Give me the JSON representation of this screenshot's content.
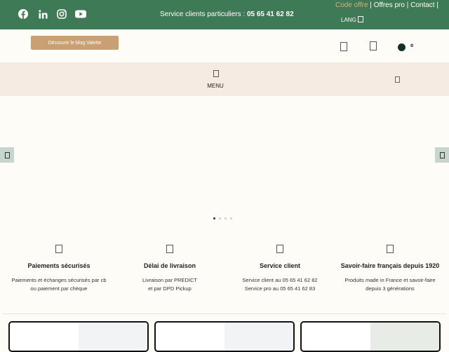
{
  "topbar": {
    "social": [
      {
        "name": "facebook-icon"
      },
      {
        "name": "linkedin-icon"
      },
      {
        "name": "instagram-icon"
      },
      {
        "name": "youtube-icon"
      }
    ],
    "service_text": "Service clients particuliers : ",
    "service_phone": "05 65 41 62 82",
    "links": {
      "code": "Code offre",
      "sep1": " | ",
      "pro": "Offres pro",
      "sep2": " | ",
      "contact": "Contact",
      "sep3": " |"
    },
    "lang": "LANG"
  },
  "header": {
    "blog_button": "Découvrir le blog Valette",
    "cart_count": "0"
  },
  "menu": {
    "label": "MENU"
  },
  "colors": {
    "green": "#3e7a55",
    "tan": "#c9a074",
    "beige": "#f5ebe3"
  },
  "features": [
    {
      "title": "Paiements sécurisés",
      "lines": [
        "Paiements et échanges sécurisés par cb",
        "ou paiement par chèque"
      ]
    },
    {
      "title": "Délai de livraison",
      "lines": [
        "Livraison par PREDICT",
        "et par DPD Pickup"
      ]
    },
    {
      "title": "Service client",
      "lines": [
        "Service client au 05 65 41 62 82",
        "Service pro au 05 65 41 62 83"
      ]
    },
    {
      "title": "Savoir-faire français depuis 1920",
      "lines": [
        "Produits made in France et savoir-faire",
        "depuis 3 générations"
      ]
    }
  ]
}
